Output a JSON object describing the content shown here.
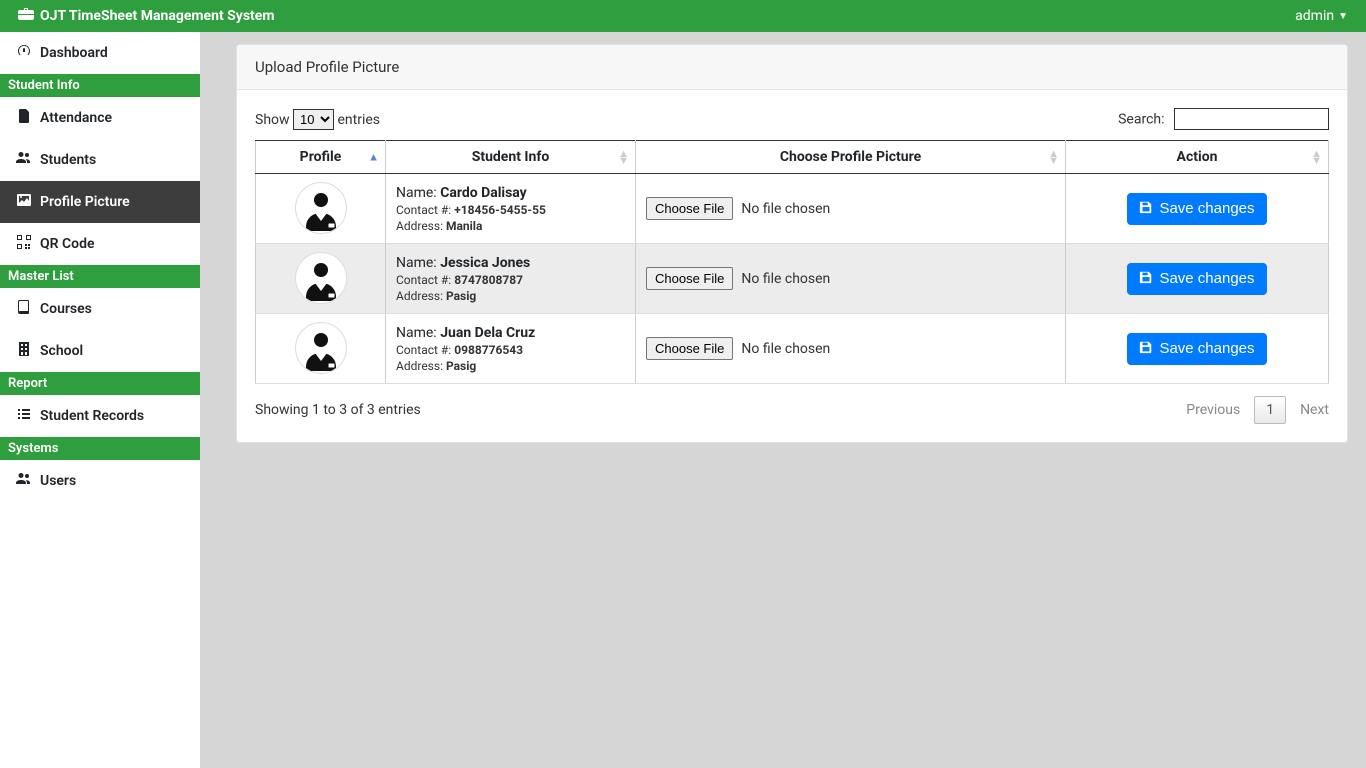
{
  "brand": {
    "title": "OJT TimeSheet Management System"
  },
  "user": {
    "name": "admin"
  },
  "sidebar": {
    "items": [
      {
        "label": "Dashboard"
      },
      {
        "label": "Attendance"
      },
      {
        "label": "Students"
      },
      {
        "label": "Profile Picture"
      },
      {
        "label": "QR Code"
      },
      {
        "label": "Courses"
      },
      {
        "label": "School"
      },
      {
        "label": "Student Records"
      },
      {
        "label": "Users"
      }
    ],
    "headers": {
      "student_info": "Student Info",
      "master_list": "Master List",
      "report": "Report",
      "systems": "Systems"
    }
  },
  "panel": {
    "title": "Upload Profile Picture"
  },
  "datatable": {
    "length": {
      "show": "Show",
      "entries": "entries",
      "value": "10"
    },
    "filter": {
      "label": "Search:",
      "value": ""
    },
    "columns": {
      "profile": "Profile",
      "student_info": "Student Info",
      "choose": "Choose Profile Picture",
      "action": "Action"
    },
    "info_labels": {
      "name": "Name:",
      "contact": "Contact #:",
      "address": "Address:"
    },
    "file": {
      "button": "Choose File",
      "no_file": "No file chosen"
    },
    "action_button": "Save changes",
    "rows": [
      {
        "name": "Cardo Dalisay",
        "contact": "+18456-5455-55",
        "address": "Manila"
      },
      {
        "name": "Jessica Jones",
        "contact": "8747808787",
        "address": "Pasig"
      },
      {
        "name": "Juan Dela Cruz",
        "contact": "0988776543",
        "address": "Pasig"
      }
    ],
    "info_text": "Showing 1 to 3 of 3 entries",
    "pager": {
      "previous": "Previous",
      "page": "1",
      "next": "Next"
    }
  }
}
